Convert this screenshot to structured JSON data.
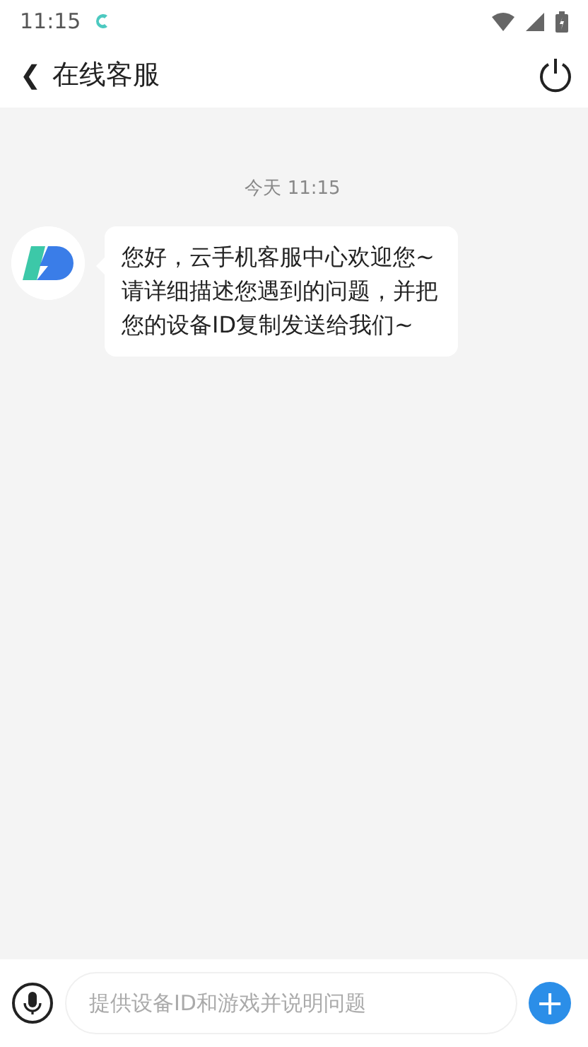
{
  "status_bar": {
    "time": "11:15"
  },
  "header": {
    "back": "❮",
    "title": "在线客服"
  },
  "messages": [
    {
      "kind": "timestamp",
      "text": "今天 11:15"
    },
    {
      "kind": "incoming",
      "text": "您好，云手机客服中心欢迎您~请详细描述您遇到的问题，并把您的设备ID复制发送给我们~"
    }
  ],
  "composer": {
    "placeholder": "提供设备ID和游戏并说明问题",
    "plus": "+"
  }
}
